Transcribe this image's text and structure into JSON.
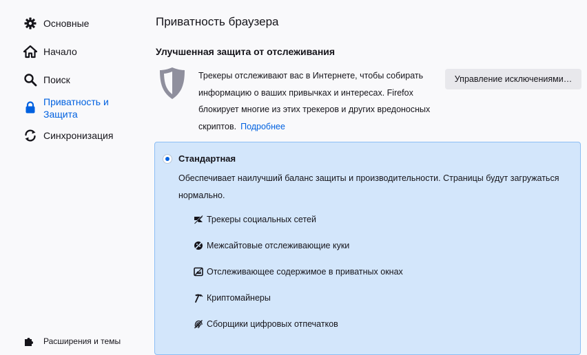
{
  "sidebar": {
    "items": [
      {
        "label": "Основные",
        "icon": "gear-icon"
      },
      {
        "label": "Начало",
        "icon": "home-icon"
      },
      {
        "label": "Поиск",
        "icon": "search-icon"
      },
      {
        "label": "Приватность и Защита",
        "icon": "lock-icon",
        "selected": true
      },
      {
        "label": "Синхронизация",
        "icon": "sync-icon"
      }
    ],
    "extensions_label": "Расширения и темы"
  },
  "main": {
    "page_title": "Приватность браузера",
    "section_title": "Улучшенная защита от отслеживания",
    "description": "Трекеры отслеживают вас в Интернете, чтобы собирать информацию о ваших привычках и интересах. Firefox блокирует многие из этих трекеров и других вредоносных скриптов.",
    "learn_more": "Подробнее",
    "exceptions_button": "Управление исключениями…"
  },
  "standard_card": {
    "title": "Стандартная",
    "selected": true,
    "description": "Обеспечивает наилучший баланс защиты и производительности. Страницы будут загружаться нормально.",
    "features": [
      {
        "label": "Трекеры социальных сетей",
        "icon": "social-tracker-icon"
      },
      {
        "label": "Межсайтовые отслеживающие куки",
        "icon": "cookie-icon"
      },
      {
        "label": "Отслеживающее содержимое в приватных окнах",
        "icon": "tracking-content-icon"
      },
      {
        "label": "Криптомайнеры",
        "icon": "cryptominer-icon"
      },
      {
        "label": "Сборщики цифровых отпечатков",
        "icon": "fingerprinter-icon"
      }
    ]
  },
  "colors": {
    "accent": "#0061e0",
    "card_bg": "#d3e6fb",
    "card_border": "#8bbdf4",
    "background": "#f9f9fb"
  }
}
